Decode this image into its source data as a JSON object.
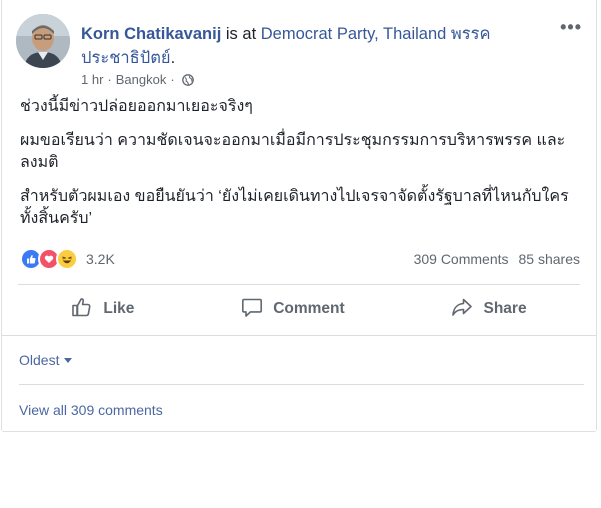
{
  "post": {
    "author": "Korn Chatikavanij",
    "location_prefix": "is at",
    "location": "Democrat Party, Thailand พรรคประชาธิปัตย์",
    "location_suffix": ".",
    "time": "1 hr",
    "separator": "·",
    "place": "Bangkok",
    "more_icon": "more-options-icon",
    "paragraphs": [
      "ช่วงนี้มีข่าวปล่อยออกมาเยอะจริงๆ",
      "ผมขอเรียนว่า ความชัดเจนจะออกมาเมื่อมีการประชุมกรรมการบริหารพรรค และลงมติ",
      "สำหรับตัวผมเอง ขอยืนยันว่า ‘ยังไม่เคยเดินทางไปเจรจาจัดตั้งรัฐบาลที่ไหนกับใครทั้งสิ้นครับ’"
    ]
  },
  "reactions": {
    "count": "3.2K",
    "icons": [
      "like-reaction-icon",
      "love-reaction-icon",
      "haha-reaction-icon"
    ],
    "comments": "309 Comments",
    "shares": "85 shares"
  },
  "actions": {
    "like": "Like",
    "comment": "Comment",
    "share": "Share"
  },
  "comments": {
    "sort": "Oldest",
    "view_all": "View all 309 comments"
  },
  "colors": {
    "link": "#365899",
    "meta": "#616770",
    "like_blue": "#3b7af5",
    "love_red": "#f25268",
    "haha_yellow": "#fbcd3f"
  }
}
